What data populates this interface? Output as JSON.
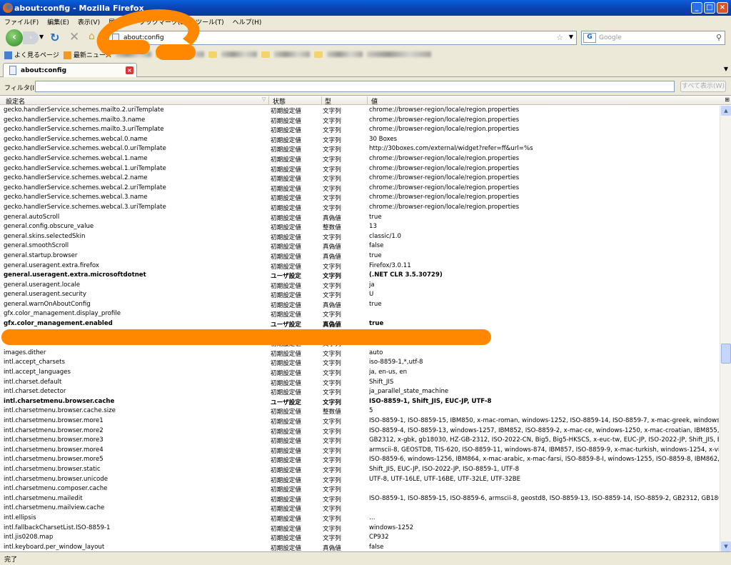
{
  "window": {
    "title": "about:config - Mozilla Firefox"
  },
  "menu": [
    "ファイル(F)",
    "編集(E)",
    "表示(V)",
    "履歴(S)",
    "ブックマーク(B)",
    "ツール(T)",
    "ヘルプ(H)"
  ],
  "nav": {
    "url": "about:config",
    "search_placeholder": "Google",
    "search_engine": "G"
  },
  "bookmarks": {
    "items": [
      "よく見るページ",
      "最新ニュース"
    ]
  },
  "tab": {
    "label": "about:config"
  },
  "filter": {
    "label": "フィルタ(I):",
    "value": "",
    "show_all": "すべて表示(W)"
  },
  "columns": {
    "name": "設定名",
    "status": "状態",
    "type": "型",
    "value": "値"
  },
  "rows": [
    {
      "n": "gecko.handlerService.schemes.mailto.2.uriTemplate",
      "s": "初期設定値",
      "t": "文字列",
      "v": "chrome://browser-region/locale/region.properties"
    },
    {
      "n": "gecko.handlerService.schemes.mailto.3.name",
      "s": "初期設定値",
      "t": "文字列",
      "v": "chrome://browser-region/locale/region.properties"
    },
    {
      "n": "gecko.handlerService.schemes.mailto.3.uriTemplate",
      "s": "初期設定値",
      "t": "文字列",
      "v": "chrome://browser-region/locale/region.properties"
    },
    {
      "n": "gecko.handlerService.schemes.webcal.0.name",
      "s": "初期設定値",
      "t": "文字列",
      "v": "30 Boxes"
    },
    {
      "n": "gecko.handlerService.schemes.webcal.0.uriTemplate",
      "s": "初期設定値",
      "t": "文字列",
      "v": "http://30boxes.com/external/widget?refer=ff&url=%s"
    },
    {
      "n": "gecko.handlerService.schemes.webcal.1.name",
      "s": "初期設定値",
      "t": "文字列",
      "v": "chrome://browser-region/locale/region.properties"
    },
    {
      "n": "gecko.handlerService.schemes.webcal.1.uriTemplate",
      "s": "初期設定値",
      "t": "文字列",
      "v": "chrome://browser-region/locale/region.properties"
    },
    {
      "n": "gecko.handlerService.schemes.webcal.2.name",
      "s": "初期設定値",
      "t": "文字列",
      "v": "chrome://browser-region/locale/region.properties"
    },
    {
      "n": "gecko.handlerService.schemes.webcal.2.uriTemplate",
      "s": "初期設定値",
      "t": "文字列",
      "v": "chrome://browser-region/locale/region.properties"
    },
    {
      "n": "gecko.handlerService.schemes.webcal.3.name",
      "s": "初期設定値",
      "t": "文字列",
      "v": "chrome://browser-region/locale/region.properties"
    },
    {
      "n": "gecko.handlerService.schemes.webcal.3.uriTemplate",
      "s": "初期設定値",
      "t": "文字列",
      "v": "chrome://browser-region/locale/region.properties"
    },
    {
      "n": "general.autoScroll",
      "s": "初期設定値",
      "t": "真偽値",
      "v": "true"
    },
    {
      "n": "general.config.obscure_value",
      "s": "初期設定値",
      "t": "整数値",
      "v": "13"
    },
    {
      "n": "general.skins.selectedSkin",
      "s": "初期設定値",
      "t": "文字列",
      "v": "classic/1.0"
    },
    {
      "n": "general.smoothScroll",
      "s": "初期設定値",
      "t": "真偽値",
      "v": "false"
    },
    {
      "n": "general.startup.browser",
      "s": "初期設定値",
      "t": "真偽値",
      "v": "true"
    },
    {
      "n": "general.useragent.extra.firefox",
      "s": "初期設定値",
      "t": "文字列",
      "v": "Firefox/3.0.11"
    },
    {
      "n": "general.useragent.extra.microsoftdotnet",
      "s": "ユーザ設定",
      "t": "文字列",
      "v": "(.NET CLR 3.5.30729)",
      "user": true
    },
    {
      "n": "general.useragent.locale",
      "s": "初期設定値",
      "t": "文字列",
      "v": "ja"
    },
    {
      "n": "general.useragent.security",
      "s": "初期設定値",
      "t": "文字列",
      "v": "U"
    },
    {
      "n": "general.warnOnAboutConfig",
      "s": "初期設定値",
      "t": "真偽値",
      "v": "true"
    },
    {
      "n": "gfx.color_management.display_profile",
      "s": "初期設定値",
      "t": "文字列",
      "v": ""
    },
    {
      "n": "gfx.color_management.enabled",
      "s": "ユーザ設定",
      "t": "真偽値",
      "v": "true",
      "user": true
    },
    {
      "n": "",
      "s": "",
      "t": "",
      "v": ""
    },
    {
      "n": "",
      "s": "初期設定値",
      "t": "文字列",
      "v": ""
    },
    {
      "n": "images.dither",
      "s": "初期設定値",
      "t": "文字列",
      "v": "auto"
    },
    {
      "n": "intl.accept_charsets",
      "s": "初期設定値",
      "t": "文字列",
      "v": "iso-8859-1,*,utf-8"
    },
    {
      "n": "intl.accept_languages",
      "s": "初期設定値",
      "t": "文字列",
      "v": "ja, en-us, en"
    },
    {
      "n": "intl.charset.default",
      "s": "初期設定値",
      "t": "文字列",
      "v": "Shift_JIS"
    },
    {
      "n": "intl.charset.detector",
      "s": "初期設定値",
      "t": "文字列",
      "v": "ja_parallel_state_machine"
    },
    {
      "n": "intl.charsetmenu.browser.cache",
      "s": "ユーザ設定",
      "t": "文字列",
      "v": "ISO-8859-1, Shift_JIS, EUC-JP, UTF-8",
      "user": true
    },
    {
      "n": "intl.charsetmenu.browser.cache.size",
      "s": "初期設定値",
      "t": "整数値",
      "v": "5"
    },
    {
      "n": "intl.charsetmenu.browser.more1",
      "s": "初期設定値",
      "t": "文字列",
      "v": "ISO-8859-1, ISO-8859-15, IBM850, x-mac-roman, windows-1252, ISO-8859-14, ISO-8859-7, x-mac-greek, windows-1253, x..."
    },
    {
      "n": "intl.charsetmenu.browser.more2",
      "s": "初期設定値",
      "t": "文字列",
      "v": "ISO-8859-4, ISO-8859-13, windows-1257, IBM852, ISO-8859-2, x-mac-ce, windows-1250, x-mac-croatian, IBM855, ISO-885..."
    },
    {
      "n": "intl.charsetmenu.browser.more3",
      "s": "初期設定値",
      "t": "文字列",
      "v": "GB2312, x-gbk, gb18030, HZ-GB-2312, ISO-2022-CN, Big5, Big5-HKSCS, x-euc-tw, EUC-JP, ISO-2022-JP, Shift_JIS, EUC-..."
    },
    {
      "n": "intl.charsetmenu.browser.more4",
      "s": "初期設定値",
      "t": "文字列",
      "v": "armscii-8, GEOSTD8, TIS-620, ISO-8859-11, windows-874, IBM857, ISO-8859-9, x-mac-turkish, windows-1254, x-viet-tcvn5..."
    },
    {
      "n": "intl.charsetmenu.browser.more5",
      "s": "初期設定値",
      "t": "文字列",
      "v": "ISO-8859-6, windows-1256, IBM864, x-mac-arabic, x-mac-farsi, ISO-8859-8-I, windows-1255, ISO-8859-8, IBM862, x-mac-..."
    },
    {
      "n": "intl.charsetmenu.browser.static",
      "s": "初期設定値",
      "t": "文字列",
      "v": "Shift_JIS, EUC-JP, ISO-2022-JP, ISO-8859-1, UTF-8"
    },
    {
      "n": "intl.charsetmenu.browser.unicode",
      "s": "初期設定値",
      "t": "文字列",
      "v": "UTF-8, UTF-16LE, UTF-16BE, UTF-32LE, UTF-32BE"
    },
    {
      "n": "intl.charsetmenu.composer.cache",
      "s": "初期設定値",
      "t": "文字列",
      "v": ""
    },
    {
      "n": "intl.charsetmenu.mailedit",
      "s": "初期設定値",
      "t": "文字列",
      "v": "ISO-8859-1, ISO-8859-15, ISO-8859-6, armscii-8, geostd8, ISO-8859-13, ISO-8859-14, ISO-8859-2, GB2312, GB18030, Big5,..."
    },
    {
      "n": "intl.charsetmenu.mailview.cache",
      "s": "初期設定値",
      "t": "文字列",
      "v": ""
    },
    {
      "n": "intl.ellipsis",
      "s": "初期設定値",
      "t": "文字列",
      "v": "…"
    },
    {
      "n": "intl.fallbackCharsetList.ISO-8859-1",
      "s": "初期設定値",
      "t": "文字列",
      "v": "windows-1252"
    },
    {
      "n": "intl.jis0208.map",
      "s": "初期設定値",
      "t": "文字列",
      "v": "CP932"
    },
    {
      "n": "intl.keyboard.per_window_layout",
      "s": "初期設定値",
      "t": "真偽値",
      "v": "false"
    }
  ],
  "status": {
    "text": "完了"
  },
  "colors": {
    "annotation": "#ff8800",
    "titlebar": "#0a4fc8"
  }
}
